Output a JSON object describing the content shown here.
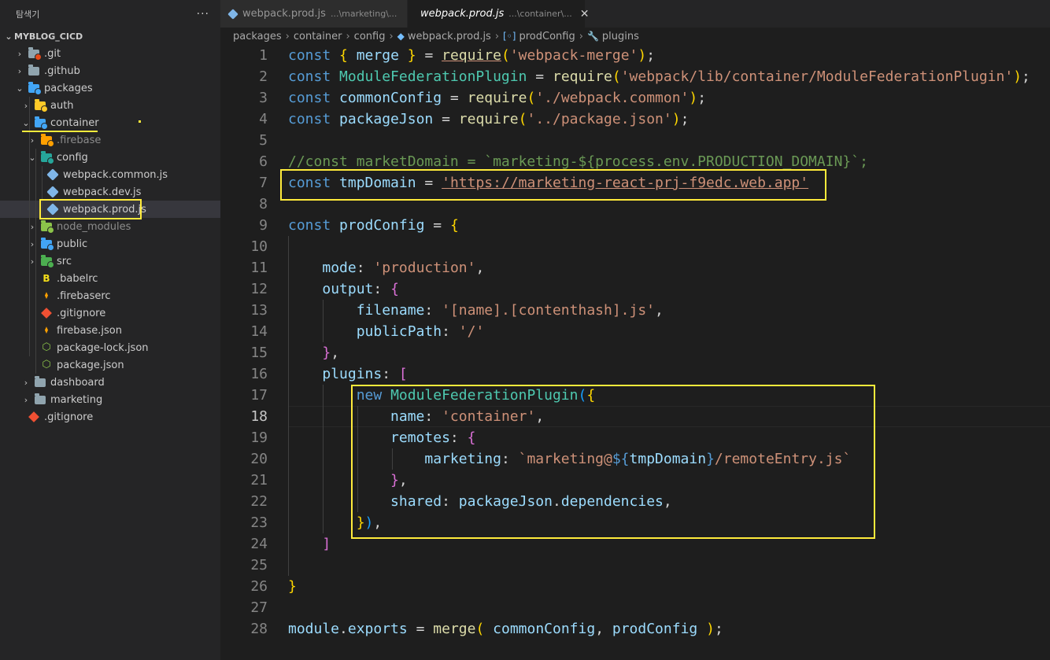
{
  "sidebar": {
    "title": "탐색기",
    "more": "···",
    "section": "MYBLOG_CICD",
    "items": [
      {
        "label": ".git",
        "depth": 1,
        "chev": "›",
        "icon": "folder-git-icon",
        "color": "#e64a19"
      },
      {
        "label": ".github",
        "depth": 1,
        "chev": "›",
        "icon": "folder-github-icon",
        "color": "#90a4ae"
      },
      {
        "label": "packages",
        "depth": 1,
        "chev": "⌄",
        "icon": "folder-packages-icon",
        "color": "#42a5f5"
      },
      {
        "label": "auth",
        "depth": 2,
        "chev": "›",
        "icon": "folder-auth-icon",
        "color": "#ffca28"
      },
      {
        "label": "container",
        "depth": 2,
        "chev": "⌄",
        "icon": "folder-container-icon",
        "color": "#42a5f5"
      },
      {
        "label": ".firebase",
        "depth": 3,
        "chev": "›",
        "icon": "folder-firebase-icon",
        "color": "#ffa000",
        "dimmed": true
      },
      {
        "label": "config",
        "depth": 3,
        "chev": "⌄",
        "icon": "folder-config-icon",
        "color": "#26a69a"
      },
      {
        "label": "webpack.common.js",
        "depth": 4,
        "chev": "",
        "icon": "webpack-icon",
        "color": "#7fb6e8"
      },
      {
        "label": "webpack.dev.js",
        "depth": 4,
        "chev": "",
        "icon": "webpack-icon",
        "color": "#7fb6e8"
      },
      {
        "label": "webpack.prod.js",
        "depth": 4,
        "chev": "",
        "icon": "webpack-icon",
        "color": "#7fb6e8",
        "selected": true
      },
      {
        "label": "node_modules",
        "depth": 3,
        "chev": "›",
        "icon": "folder-node-icon",
        "color": "#8bc34a",
        "dimmed": true
      },
      {
        "label": "public",
        "depth": 3,
        "chev": "›",
        "icon": "folder-public-icon",
        "color": "#42a5f5"
      },
      {
        "label": "src",
        "depth": 3,
        "chev": "›",
        "icon": "folder-src-icon",
        "color": "#4caf50"
      },
      {
        "label": ".babelrc",
        "depth": 3,
        "chev": "",
        "icon": "babel-icon",
        "color": "#f5de19"
      },
      {
        "label": ".firebaserc",
        "depth": 3,
        "chev": "",
        "icon": "firebase-icon",
        "color": "#ffa000"
      },
      {
        "label": ".gitignore",
        "depth": 3,
        "chev": "",
        "icon": "git-icon",
        "color": "#f05033"
      },
      {
        "label": "firebase.json",
        "depth": 3,
        "chev": "",
        "icon": "firebase-icon",
        "color": "#ffa000"
      },
      {
        "label": "package-lock.json",
        "depth": 3,
        "chev": "",
        "icon": "npm-icon",
        "color": "#8bc34a"
      },
      {
        "label": "package.json",
        "depth": 3,
        "chev": "",
        "icon": "npm-icon",
        "color": "#8bc34a"
      },
      {
        "label": "dashboard",
        "depth": 2,
        "chev": "›",
        "icon": "folder-icon",
        "color": "#90a4ae"
      },
      {
        "label": "marketing",
        "depth": 2,
        "chev": "›",
        "icon": "folder-icon",
        "color": "#90a4ae"
      },
      {
        "label": ".gitignore",
        "depth": 1,
        "chev": "",
        "icon": "git-icon",
        "color": "#f05033"
      }
    ]
  },
  "tabs": [
    {
      "name": "webpack.prod.js",
      "path": "...\\marketing\\...",
      "active": false
    },
    {
      "name": "webpack.prod.js",
      "path": "...\\container\\...",
      "active": true,
      "close": "✕"
    }
  ],
  "breadcrumb": [
    "packages",
    "container",
    "config",
    "webpack.prod.js",
    "prodConfig",
    "plugins"
  ],
  "editor": {
    "active_line": 18,
    "lines": [
      {
        "n": "1"
      },
      {
        "n": "2"
      },
      {
        "n": "3"
      },
      {
        "n": "4"
      },
      {
        "n": "5"
      },
      {
        "n": "6"
      },
      {
        "n": "7"
      },
      {
        "n": "8"
      },
      {
        "n": "9"
      },
      {
        "n": "10"
      },
      {
        "n": "11"
      },
      {
        "n": "12"
      },
      {
        "n": "13"
      },
      {
        "n": "14"
      },
      {
        "n": "15"
      },
      {
        "n": "16"
      },
      {
        "n": "17"
      },
      {
        "n": "18"
      },
      {
        "n": "19"
      },
      {
        "n": "20"
      },
      {
        "n": "21"
      },
      {
        "n": "22"
      },
      {
        "n": "23"
      },
      {
        "n": "24"
      },
      {
        "n": "25"
      },
      {
        "n": "26"
      },
      {
        "n": "27"
      },
      {
        "n": "28"
      }
    ],
    "code": {
      "l1": [
        "const",
        "{",
        "merge",
        "}",
        "=",
        "require",
        "(",
        "'webpack-merge'",
        ")",
        ";"
      ],
      "l2": [
        "const",
        "ModuleFederationPlugin",
        "=",
        "require",
        "(",
        "'webpack/lib/container/ModuleFederationPlugin'",
        ")",
        ";"
      ],
      "l3": [
        "const",
        "commonConfig",
        "=",
        "require",
        "(",
        "'./webpack.common'",
        ")",
        ";"
      ],
      "l4": [
        "const",
        "packageJson",
        "=",
        "require",
        "(",
        "'../package.json'",
        ")",
        ";"
      ],
      "l6": "//const marketDomain = `marketing-${process.env.PRODUCTION_DOMAIN}`;",
      "l7": [
        "const",
        "tmpDomain",
        "=",
        "'https://marketing-react-prj-f9edc.web.app'"
      ],
      "l9": [
        "const",
        "prodConfig",
        "=",
        "{"
      ],
      "l11": [
        "mode",
        ":",
        "'production'",
        ","
      ],
      "l12": [
        "output",
        ":",
        "{"
      ],
      "l13": [
        "filename",
        ":",
        "'[name].[contenthash].js'",
        ","
      ],
      "l14": [
        "publicPath",
        ":",
        "'/'"
      ],
      "l15": [
        "}",
        ","
      ],
      "l16": [
        "plugins",
        ":",
        "["
      ],
      "l17": [
        "new",
        "ModuleFederationPlugin",
        "(",
        "{"
      ],
      "l18": [
        "name",
        ":",
        "'container'",
        ","
      ],
      "l19": [
        "remotes",
        ":",
        "{"
      ],
      "l20": [
        "marketing",
        ":",
        "`marketing@",
        "${",
        "tmpDomain",
        "}",
        "/remoteEntry.js`"
      ],
      "l21": [
        "}",
        ","
      ],
      "l22": [
        "shared",
        ":",
        "packageJson",
        ".",
        "dependencies",
        ","
      ],
      "l23": [
        "}",
        ")",
        ","
      ],
      "l24": [
        "]"
      ],
      "l26": [
        "}"
      ],
      "l28": [
        "module",
        ".",
        "exports",
        "=",
        "merge",
        "(",
        "commonConfig",
        ",",
        "prodConfig",
        ")",
        ";"
      ]
    }
  },
  "colors": {
    "highlight": "#ffeb3b",
    "keyword": "#569cd6",
    "string": "#ce9178",
    "variable": "#9cdcfe"
  }
}
